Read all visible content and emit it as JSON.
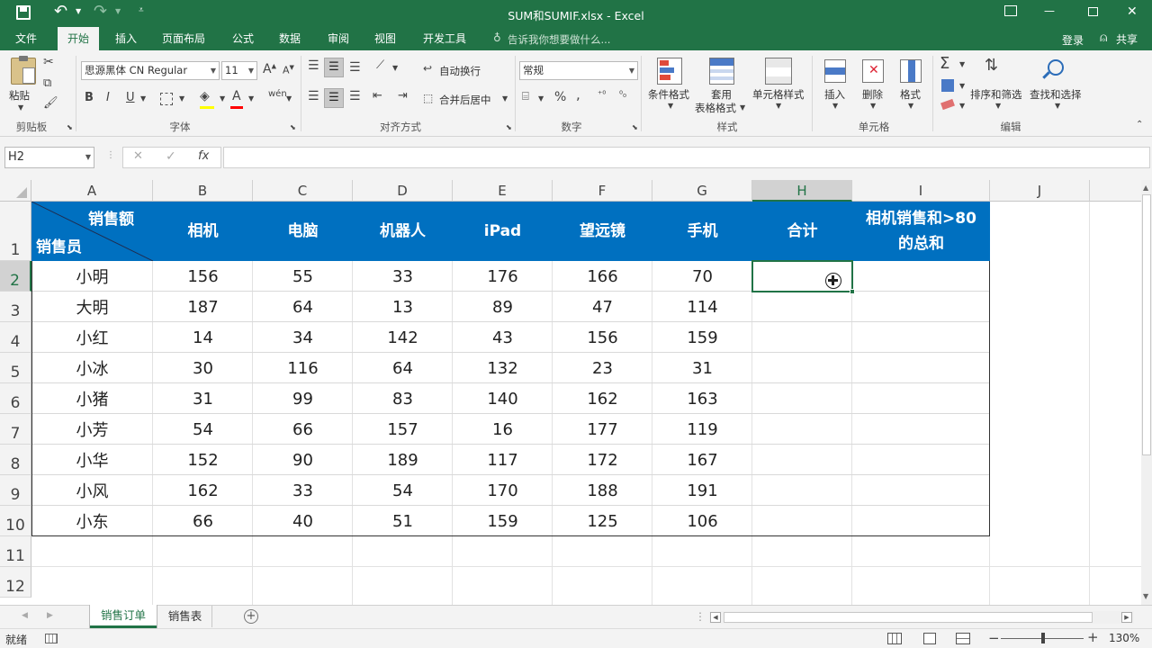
{
  "window": {
    "title": "SUM和SUMIF.xlsx - Excel",
    "min_glyph": "—",
    "max_glyph": "☐",
    "close_glyph": "✕"
  },
  "qat": {
    "save_icon": "save-icon",
    "undo_icon": "undo-icon",
    "redo_icon": "redo-icon"
  },
  "tabs": [
    "文件",
    "开始",
    "插入",
    "页面布局",
    "公式",
    "数据",
    "审阅",
    "视图",
    "开发工具"
  ],
  "tellme": "告诉我你想要做什么...",
  "login": "登录",
  "share": "共享",
  "ribbon": {
    "paste_label": "粘贴",
    "clipboard_group": "剪贴板",
    "font_name": "思源黑体 CN Regular",
    "font_size": "11",
    "font_group": "字体",
    "bold": "B",
    "italic": "I",
    "underline": "U",
    "phonetic": "wén",
    "wrap_text": "自动换行",
    "merge_center": "合并后居中",
    "align_group": "对齐方式",
    "number_format": "常规",
    "number_group": "数字",
    "percent": "%",
    "comma": ",",
    "cond_format": "条件格式",
    "table_format_1": "套用",
    "table_format_2": "表格格式",
    "cell_styles": "单元格样式",
    "styles_group": "样式",
    "insert": "插入",
    "delete": "删除",
    "format": "格式",
    "cells_group": "单元格",
    "sort_filter": "排序和筛选",
    "find_select": "查找和选择",
    "edit_group": "编辑",
    "sigma": "Σ"
  },
  "formula_bar": {
    "name_box": "H2",
    "fx": "fx",
    "cancel": "✕",
    "enter": "✓",
    "value": ""
  },
  "columns": [
    "A",
    "B",
    "C",
    "D",
    "E",
    "F",
    "G",
    "H",
    "I",
    "J"
  ],
  "rows": [
    "1",
    "2",
    "3",
    "4",
    "5",
    "6",
    "7",
    "8",
    "9",
    "10",
    "11",
    "12"
  ],
  "table": {
    "header_top": "销售额",
    "header_bottom": "销售员",
    "products": [
      "相机",
      "电脑",
      "机器人",
      "iPad",
      "望远镜",
      "手机"
    ],
    "total": "合计",
    "camera_sum_1": "相机销售和>80",
    "camera_sum_2": "的总和",
    "header_color": "#0070c0",
    "data": [
      {
        "name": "小明",
        "values": [
          "156",
          "55",
          "33",
          "176",
          "166",
          "70"
        ]
      },
      {
        "name": "大明",
        "values": [
          "187",
          "64",
          "13",
          "89",
          "47",
          "114"
        ]
      },
      {
        "name": "小红",
        "values": [
          "14",
          "34",
          "142",
          "43",
          "156",
          "159"
        ]
      },
      {
        "name": "小冰",
        "values": [
          "30",
          "116",
          "64",
          "132",
          "23",
          "31"
        ]
      },
      {
        "name": "小猪",
        "values": [
          "31",
          "99",
          "83",
          "140",
          "162",
          "163"
        ]
      },
      {
        "name": "小芳",
        "values": [
          "54",
          "66",
          "157",
          "16",
          "177",
          "119"
        ]
      },
      {
        "name": "小华",
        "values": [
          "152",
          "90",
          "189",
          "117",
          "172",
          "167"
        ]
      },
      {
        "name": "小风",
        "values": [
          "162",
          "33",
          "54",
          "170",
          "188",
          "191"
        ]
      },
      {
        "name": "小东",
        "values": [
          "66",
          "40",
          "51",
          "159",
          "125",
          "106"
        ]
      }
    ]
  },
  "sheets": {
    "active": "销售订单",
    "other": "销售表",
    "add": "+"
  },
  "status": {
    "mode": "就绪",
    "zoom": "130%",
    "zoom_minus": "−",
    "zoom_plus": "+"
  },
  "accent": "#217346"
}
